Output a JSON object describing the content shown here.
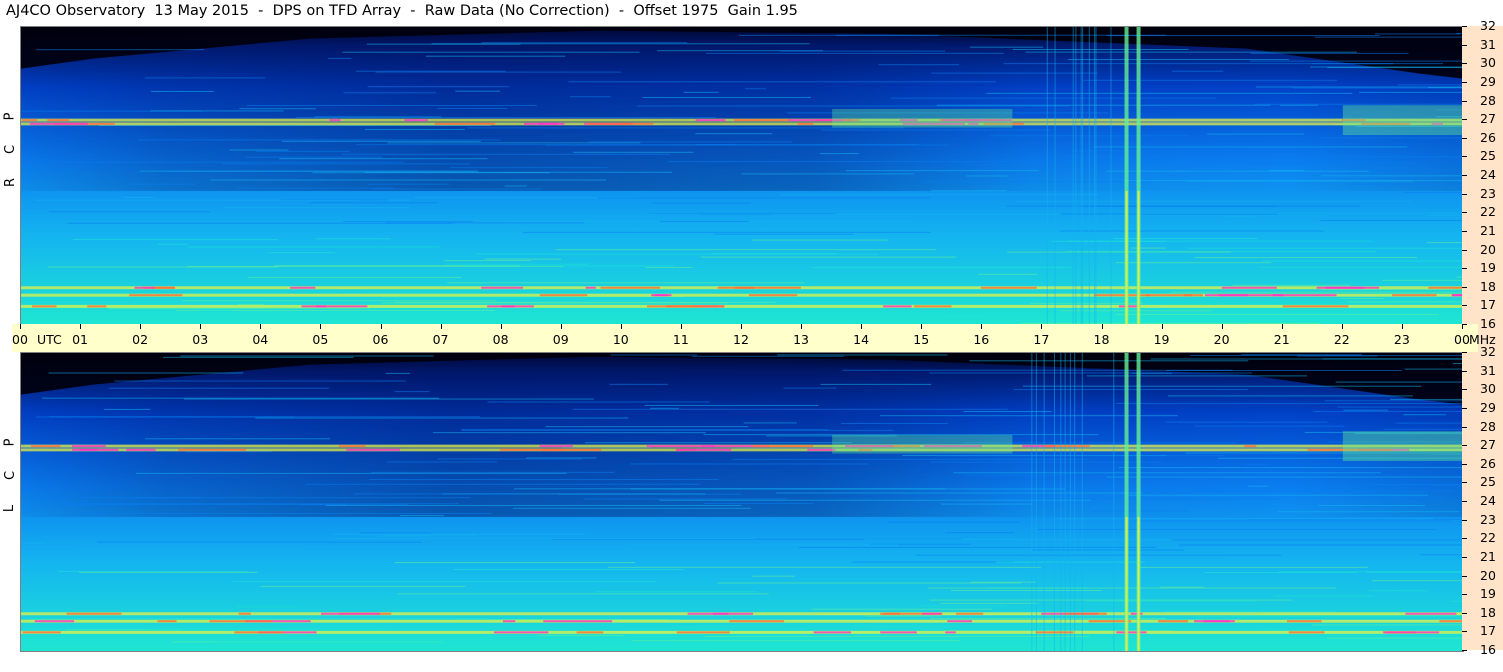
{
  "page": {
    "title": "AJ4CO Observatory  13 May 2015  -  DPS on TFD Array  -  Raw Data (No Correction)  -  Offset 1975  Gain 1.95"
  },
  "chart_data": [
    {
      "type": "heatmap",
      "panel": "rcp",
      "side_label_letters": [
        "R",
        "C",
        "P"
      ],
      "x_unit_label": "UTC",
      "y_unit_label": "MHz",
      "x_ticks": [
        "00",
        "01",
        "02",
        "03",
        "04",
        "05",
        "06",
        "07",
        "08",
        "09",
        "10",
        "11",
        "12",
        "13",
        "14",
        "15",
        "16",
        "17",
        "18",
        "19",
        "20",
        "21",
        "22",
        "23",
        "00"
      ],
      "y_ticks": [
        16,
        17,
        18,
        19,
        20,
        21,
        22,
        23,
        24,
        25,
        26,
        27,
        28,
        29,
        30,
        31,
        32
      ],
      "xlim": [
        0,
        24
      ],
      "ylim": [
        16,
        32
      ],
      "colormap": [
        "#000010",
        "#001a6e",
        "#0041c8",
        "#0a7ef0",
        "#14b4f0",
        "#1ee6d2",
        "#64f096",
        "#e6f046",
        "#ff6e3c",
        "#ff32c8"
      ],
      "cutoff_freq_mhz_night": 30.3,
      "strong_bands_mhz": [
        17.0,
        17.6,
        18.0,
        27.0,
        26.8
      ],
      "strong_vertical_utc": [
        18.4,
        18.6
      ]
    },
    {
      "type": "heatmap",
      "panel": "lcp",
      "side_label_letters": [
        "L",
        "C",
        "P"
      ],
      "x_unit_label": "UTC",
      "y_unit_label": "MHz",
      "x_ticks": [
        "00",
        "01",
        "02",
        "03",
        "04",
        "05",
        "06",
        "07",
        "08",
        "09",
        "10",
        "11",
        "12",
        "13",
        "14",
        "15",
        "16",
        "17",
        "18",
        "19",
        "20",
        "21",
        "22",
        "23",
        "00"
      ],
      "y_ticks": [
        16,
        17,
        18,
        19,
        20,
        21,
        22,
        23,
        24,
        25,
        26,
        27,
        28,
        29,
        30,
        31,
        32
      ],
      "xlim": [
        0,
        24
      ],
      "ylim": [
        16,
        32
      ],
      "colormap": [
        "#000010",
        "#001a6e",
        "#0041c8",
        "#0a7ef0",
        "#14b4f0",
        "#1ee6d2",
        "#64f096",
        "#e6f046",
        "#ff6e3c",
        "#ff32c8"
      ],
      "cutoff_freq_mhz_night": 30.3,
      "strong_bands_mhz": [
        17.0,
        17.6,
        18.0,
        27.0,
        26.8
      ],
      "strong_vertical_utc": [
        18.4,
        18.6
      ]
    }
  ]
}
